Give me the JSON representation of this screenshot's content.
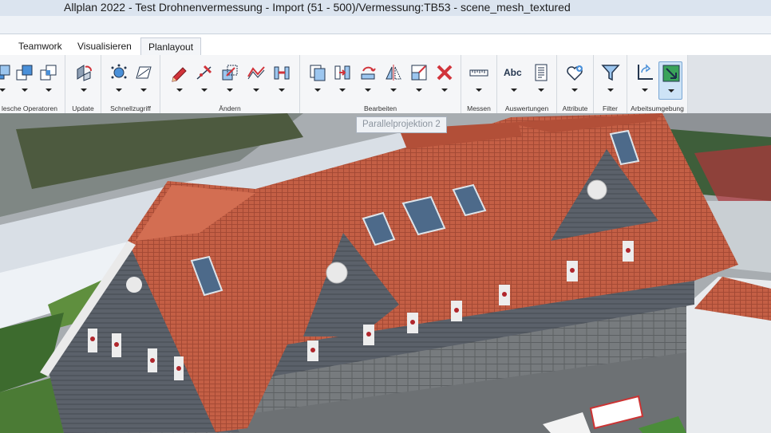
{
  "window": {
    "title": "Allplan 2022 - Test Drohnenvermessung - Import (51 - 500)/Vermessung:TB53 - scene_mesh_textured"
  },
  "tabs": [
    {
      "label": "Teamwork"
    },
    {
      "label": "Visualisieren"
    },
    {
      "label": "Planlayout"
    }
  ],
  "ribbon": {
    "groups": [
      {
        "label": "lesche Operatoren"
      },
      {
        "label": "Update"
      },
      {
        "label": "Schnellzugriff"
      },
      {
        "label": "Ändern"
      },
      {
        "label": "Bearbeiten"
      },
      {
        "label": "Messen"
      },
      {
        "label": "Auswertungen"
      },
      {
        "label": "Attribute"
      },
      {
        "label": "Filter"
      },
      {
        "label": "Arbeitsumgebung"
      }
    ],
    "text_tool": "Abc"
  },
  "viewport": {
    "tooltip": "Parallelprojektion 2"
  },
  "colors": {
    "ribbon_bg": "#f5f6f8",
    "roof": "#c45f45",
    "selection": "#cde3f6"
  }
}
